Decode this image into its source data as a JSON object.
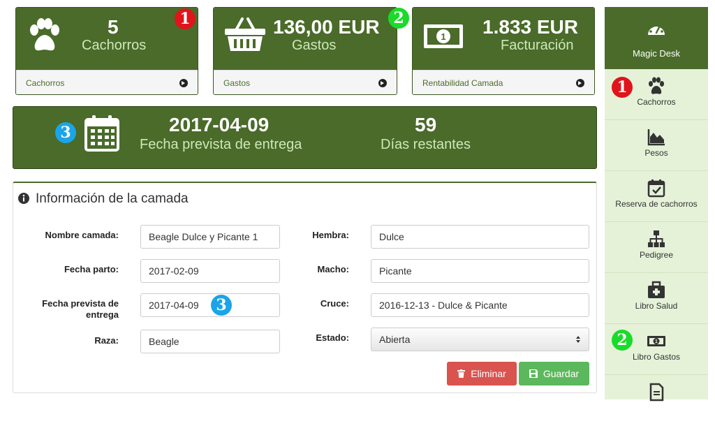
{
  "cards": [
    {
      "value": "5",
      "label": "Cachorros",
      "link": "Cachorros",
      "badge": "1"
    },
    {
      "value": "136,00 EUR",
      "label": "Gastos",
      "link": "Gastos",
      "badge": "2"
    },
    {
      "value": "1.833 EUR",
      "label": "Facturación",
      "link": "Rentabilidad Camada"
    }
  ],
  "banner": {
    "date": "2017-04-09",
    "date_label": "Fecha prevista de entrega",
    "days": "59",
    "days_label": "Días restantes",
    "badge": "3"
  },
  "panel": {
    "title": "Información de la camada",
    "fields_left": [
      {
        "label": "Nombre camada:",
        "value": "Beagle Dulce y Picante 1"
      },
      {
        "label": "Fecha parto:",
        "value": "2017-02-09"
      },
      {
        "label": "Fecha prevista de entrega",
        "value": "2017-04-09",
        "badge": "3"
      },
      {
        "label": "Raza:",
        "value": "Beagle"
      }
    ],
    "fields_right": [
      {
        "label": "Hembra:",
        "value": "Dulce"
      },
      {
        "label": "Macho:",
        "value": "Picante"
      },
      {
        "label": "Cruce:",
        "value": "2016-12-13 - Dulce & Picante"
      },
      {
        "label": "Estado:",
        "value": "Abierta"
      }
    ],
    "delete_label": "Eliminar",
    "save_label": "Guardar"
  },
  "sidebar": {
    "header": "Magic Desk",
    "items": [
      {
        "label": "Cachorros",
        "icon": "paw-icon",
        "badge": "1"
      },
      {
        "label": "Pesos",
        "icon": "area-chart-icon"
      },
      {
        "label": "Reserva de cachorros",
        "icon": "calendar-check-icon"
      },
      {
        "label": "Pedigree",
        "icon": "sitemap-icon"
      },
      {
        "label": "Libro Salud",
        "icon": "medkit-icon"
      },
      {
        "label": "Libro Gastos",
        "icon": "money-icon",
        "badge": "2"
      },
      {
        "label": "",
        "icon": "document-icon"
      }
    ]
  },
  "colors": {
    "brand_green": "#4a6b2a",
    "label_green": "#cde9b8",
    "sidebar_bg": "#e5f2d8",
    "delete": "#d9534f",
    "save": "#5cb85c",
    "badge_red": "#e0141b",
    "badge_green": "#1adb2a",
    "badge_blue": "#1ba5e8"
  }
}
